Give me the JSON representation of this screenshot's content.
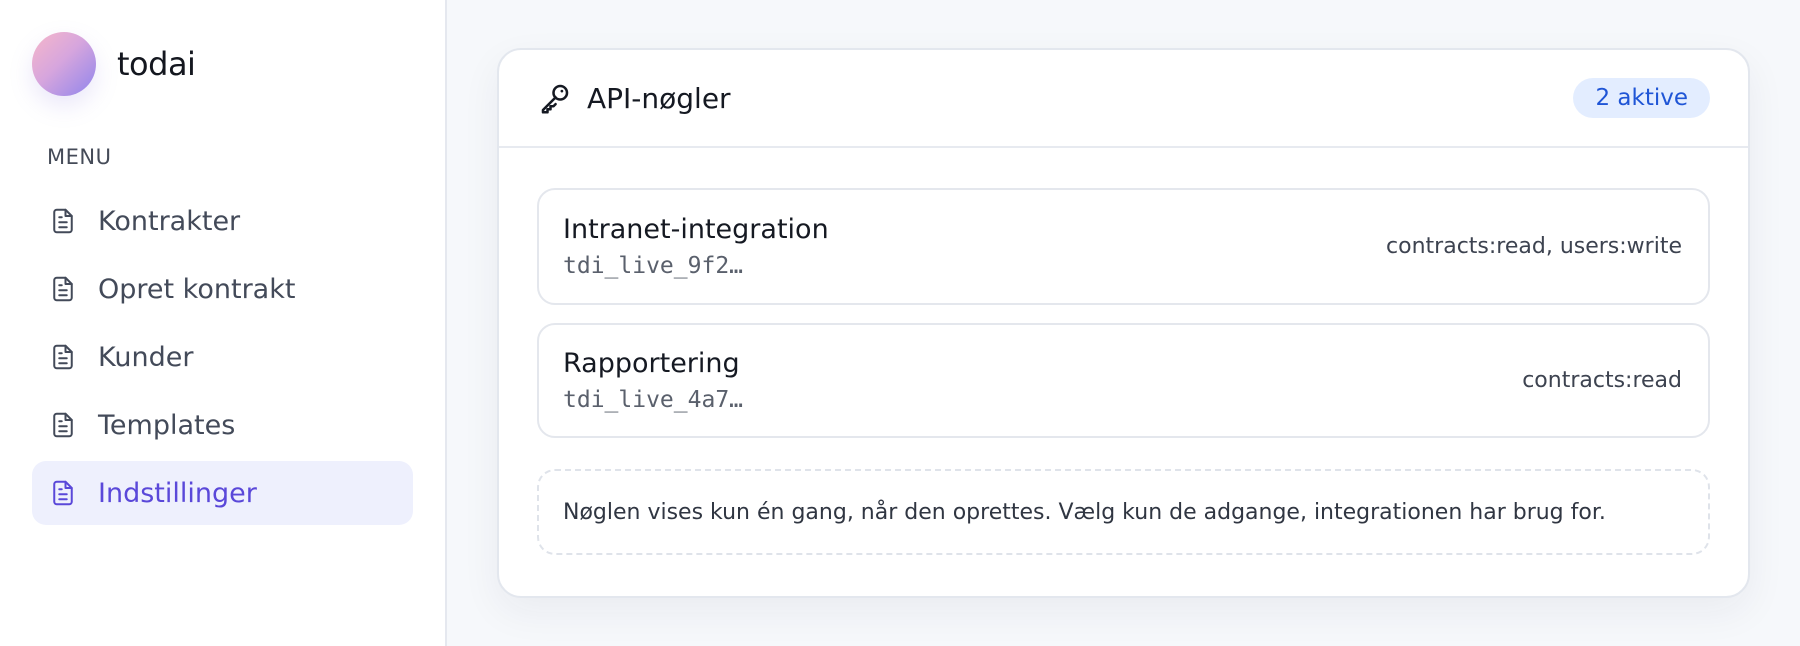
{
  "brand": {
    "name": "todai"
  },
  "sidebar": {
    "menu_label": "MENU",
    "items": [
      {
        "label": "Kontrakter",
        "icon": "document-icon",
        "active": false
      },
      {
        "label": "Opret kontrakt",
        "icon": "document-icon",
        "active": false
      },
      {
        "label": "Kunder",
        "icon": "document-icon",
        "active": false
      },
      {
        "label": "Templates",
        "icon": "document-icon",
        "active": false
      },
      {
        "label": "Indstillinger",
        "icon": "document-icon",
        "active": true
      }
    ]
  },
  "card": {
    "title": "API-nøgler",
    "icon": "key-icon",
    "badge": "2 aktive",
    "keys": [
      {
        "name": "Intranet-integration",
        "prefix": "tdi_live_9f2…",
        "scopes": "contracts:read, users:write"
      },
      {
        "name": "Rapportering",
        "prefix": "tdi_live_4a7…",
        "scopes": "contracts:read"
      }
    ],
    "note": "Nøglen vises kun én gang, når den oprettes. Vælg kun de adgange, integrationen har brug for."
  },
  "colors": {
    "accent": "#5a48d9",
    "active_bg": "#eef0fd",
    "badge_bg": "#e3edff",
    "badge_text": "#1f55d6"
  }
}
